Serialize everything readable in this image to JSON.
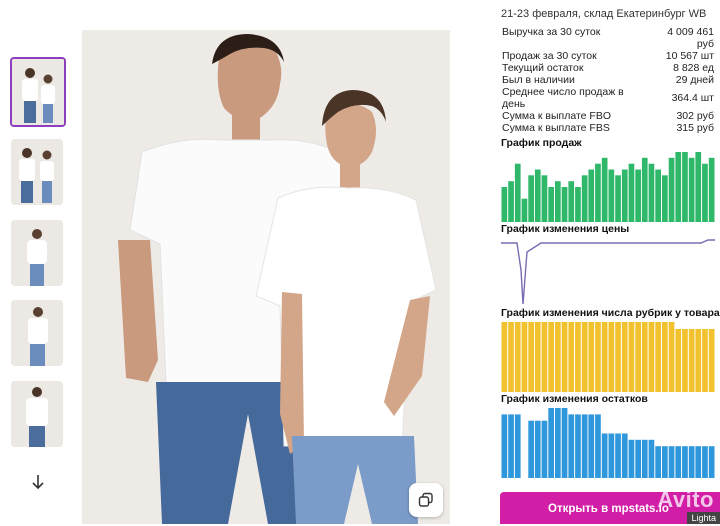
{
  "gallery": {
    "thumbs": [
      "couple-front",
      "couple-side",
      "woman-front",
      "woman-side",
      "man-front"
    ],
    "scroll_down_icon": "arrow-down-icon",
    "zoom_icon": "copy-icon"
  },
  "panel": {
    "header": "21-23 февраля, склад Екатеринбург WB",
    "stats": [
      {
        "label": "Выручка за 30 суток",
        "value": "4 009 461 руб"
      },
      {
        "label": "Продаж за 30 суток",
        "value": "10 567 шт"
      },
      {
        "label": "Текущий остаток",
        "value": "8 828 ед"
      },
      {
        "label": "Был в наличии",
        "value": "29 дней"
      },
      {
        "label": "Среднее число продаж в день",
        "value": "364.4 шт"
      },
      {
        "label": "Сумма к выплате FBO",
        "value": "302 руб"
      },
      {
        "label": "Сумма к выплате FBS",
        "value": "315 руб"
      }
    ],
    "charts": {
      "sales_title": "График продаж",
      "price_title": "График изменения цены",
      "rubrics_title": "График изменения числа рубрик у товара",
      "stock_title": "График изменения остатков"
    },
    "open_button": "Открыть в mpstats.io",
    "watermark": "Avito",
    "light_badge": "Lighta"
  },
  "colors": {
    "sales": "#2fb86a",
    "price": "#7b6bb0",
    "rubrics": "#f2c12e",
    "stock": "#2f97dc",
    "button": "#d21ea6",
    "active_thumb_border": "#8e3fbf"
  },
  "chart_data": [
    {
      "type": "bar",
      "name": "sales",
      "values": [
        6,
        7,
        10,
        4,
        8,
        9,
        8,
        6,
        7,
        6,
        7,
        6,
        8,
        9,
        10,
        11,
        9,
        8,
        9,
        10,
        9,
        11,
        10,
        9,
        8,
        11,
        12,
        12,
        11,
        12,
        10,
        11
      ]
    },
    {
      "type": "line",
      "name": "price",
      "values": [
        10,
        10,
        10,
        10,
        10,
        10,
        10,
        10,
        10,
        10,
        10,
        10,
        10,
        10,
        10,
        10,
        10,
        10,
        10,
        10,
        10,
        10,
        10,
        10,
        10,
        10,
        10,
        10,
        10,
        10,
        10,
        10,
        10,
        10,
        10,
        10,
        10,
        10,
        10,
        10,
        10,
        10,
        10,
        10,
        10,
        10,
        10,
        10,
        10,
        10,
        10,
        10,
        10,
        10,
        10,
        10,
        10,
        10,
        10,
        10,
        10,
        10,
        10,
        10,
        10,
        10,
        10,
        10,
        10,
        10,
        10,
        10,
        10,
        10,
        10,
        10,
        10,
        10,
        10,
        10,
        10,
        10,
        10,
        10,
        10,
        10,
        10,
        10,
        10,
        10,
        10,
        10,
        10,
        10,
        10,
        10,
        10,
        10,
        10,
        10,
        10,
        10,
        10,
        10,
        10,
        10,
        10,
        10,
        10,
        10,
        10,
        10,
        10,
        10,
        10,
        10,
        10,
        10,
        10,
        10,
        10,
        10,
        10,
        10,
        10,
        10,
        10,
        10,
        10,
        10,
        10,
        10,
        10,
        10,
        10,
        10,
        10,
        10,
        10,
        10,
        10,
        10,
        10,
        10,
        10,
        10,
        10,
        10,
        10,
        10,
        10,
        10,
        10,
        10,
        10,
        10,
        10,
        10,
        10,
        10,
        10,
        10,
        10,
        10,
        10,
        10,
        10,
        10,
        10,
        10,
        10,
        10,
        10,
        10,
        10,
        10,
        10,
        10,
        10,
        10,
        10,
        10,
        10,
        10,
        10,
        10,
        10,
        10,
        10,
        10,
        10,
        10,
        10,
        10,
        10,
        10,
        10,
        10,
        10,
        10,
        10,
        11,
        11
      ]
    },
    {
      "type": "bar",
      "name": "rubrics",
      "values": [
        10,
        10,
        10,
        10,
        10,
        10,
        10,
        10,
        10,
        10,
        10,
        10,
        10,
        10,
        10,
        10,
        10,
        10,
        10,
        10,
        10,
        10,
        10,
        10,
        10,
        10,
        9,
        9,
        9,
        9,
        9,
        9
      ]
    },
    {
      "type": "bar",
      "name": "stock",
      "values": [
        10,
        10,
        10,
        0,
        9,
        9,
        9,
        11,
        11,
        11,
        10,
        10,
        10,
        10,
        10,
        7,
        7,
        7,
        7,
        6,
        6,
        6,
        6,
        5,
        5,
        5,
        5,
        5,
        5,
        5,
        5,
        5
      ]
    }
  ]
}
